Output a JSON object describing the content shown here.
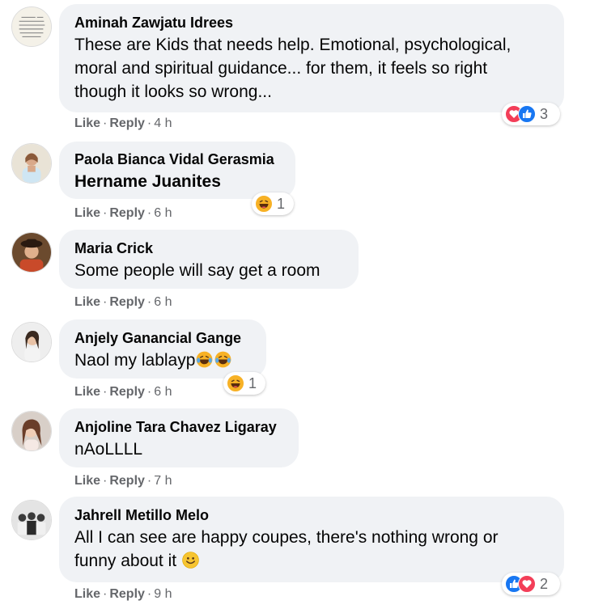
{
  "comments": [
    {
      "author": "Aminah Zawjatu Idrees",
      "lines": [
        "These are Kids that needs help. Emotional, psychological,",
        "moral and spiritual guidance... for them, it feels so right",
        "though it looks so wrong..."
      ],
      "like": "Like",
      "reply": "Reply",
      "time": "4 h",
      "reactions": {
        "icons": [
          "love-icon",
          "like-icon"
        ],
        "count": "3"
      }
    },
    {
      "author": "Paola Bianca Vidal Gerasmia",
      "lines": [
        "Hername Juanites"
      ],
      "like": "Like",
      "reply": "Reply",
      "time": "6 h",
      "reactions": {
        "icons": [
          "haha-icon"
        ],
        "count": "1"
      }
    },
    {
      "author": "Maria Crick",
      "lines": [
        "Some people will say get a room"
      ],
      "like": "Like",
      "reply": "Reply",
      "time": "6 h"
    },
    {
      "author": "Anjely Ganancial Gange",
      "lines": [
        "Naol my lablayp"
      ],
      "inline_emojis": [
        "tears-of-joy-emoji",
        "tears-of-joy-emoji"
      ],
      "like": "Like",
      "reply": "Reply",
      "time": "6 h",
      "reactions": {
        "icons": [
          "haha-icon"
        ],
        "count": "1"
      }
    },
    {
      "author": "Anjoline Tara Chavez Ligaray",
      "lines": [
        "nAoLLLL"
      ],
      "like": "Like",
      "reply": "Reply",
      "time": "7 h"
    },
    {
      "author": "Jahrell Metillo Melo",
      "lines": [
        "All I can see are happy coupes, there's nothing wrong or",
        "funny about it"
      ],
      "inline_emojis": [
        "smile-emoji"
      ],
      "like": "Like",
      "reply": "Reply",
      "time": "9 h",
      "reactions": {
        "icons": [
          "like-icon",
          "love-icon"
        ],
        "count": "2"
      }
    }
  ],
  "separator": "·",
  "colors": {
    "bubble": "#f0f2f5",
    "meta": "#65676b",
    "like_blue": "#1877f2",
    "love_red": "#f33e58",
    "haha_yellow": "#f7b125"
  }
}
